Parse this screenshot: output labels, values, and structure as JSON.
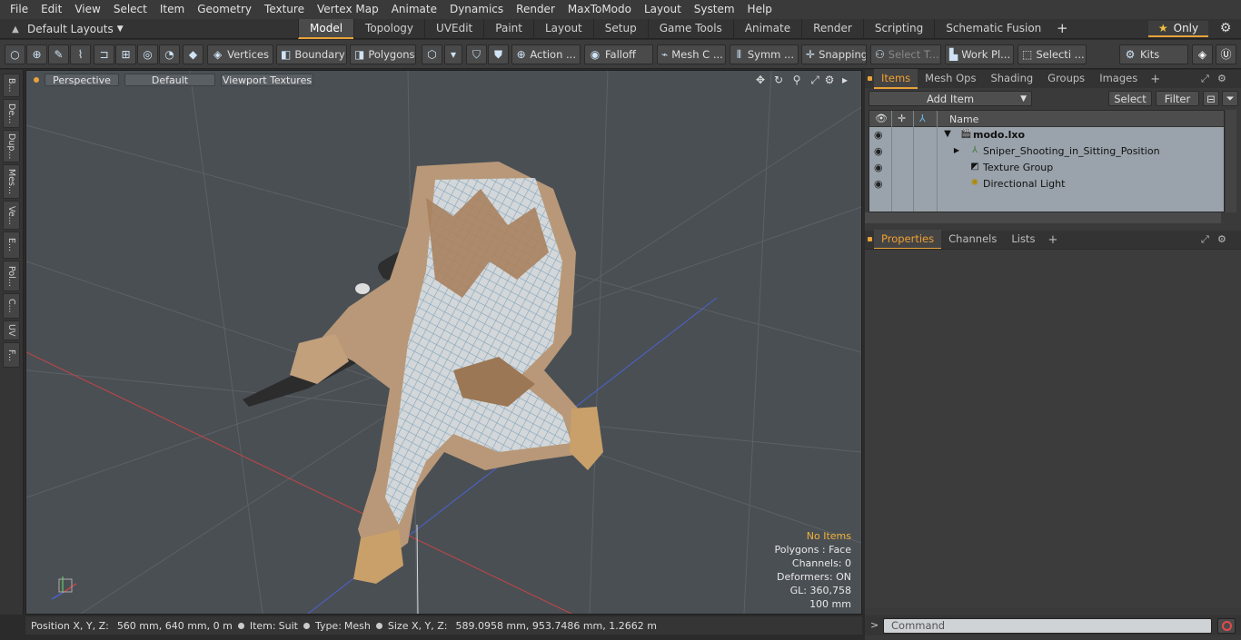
{
  "menu": [
    "File",
    "Edit",
    "View",
    "Select",
    "Item",
    "Geometry",
    "Texture",
    "Vertex Map",
    "Animate",
    "Dynamics",
    "Render",
    "MaxToModo",
    "Layout",
    "System",
    "Help"
  ],
  "layout_select": "Default Layouts",
  "tabs": [
    "Model",
    "Topology",
    "UVEdit",
    "Paint",
    "Layout",
    "Setup",
    "Game Tools",
    "Animate",
    "Render",
    "Scripting",
    "Schematic Fusion"
  ],
  "active_tab": "Model",
  "only_label": "Only",
  "toolbar": {
    "vertices": "Vertices",
    "boundary": "Boundary",
    "polygons": "Polygons",
    "action": "Action ...",
    "falloff": "Falloff",
    "mesh_c": "Mesh C ...",
    "symm": "Symm ...",
    "snapping": "Snapping",
    "select_t": "Select T...",
    "work_pl": "Work Pl...",
    "selecti": "Selecti ...",
    "kits": "Kits"
  },
  "left_tabs": [
    "B...",
    "De...",
    "Dup...",
    "Mes...",
    "Ve...",
    "E...",
    "Pol...",
    "C...",
    "UV",
    "F..."
  ],
  "viewport": {
    "view": "Perspective",
    "shading": "Default",
    "textures": "Viewport Textures",
    "info": {
      "status": "No Items",
      "polygons": "Polygons : Face",
      "channels": "Channels: 0",
      "deformers": "Deformers: ON",
      "gl": "GL: 360,758",
      "unit": "100 mm"
    }
  },
  "statusbar": {
    "position_label": "Position X, Y, Z:",
    "position_value": "560 mm, 640 mm, 0 m",
    "item_label": "Item:",
    "item_value": "Suit",
    "type_label": "Type:",
    "type_value": "Mesh",
    "size_label": "Size X, Y, Z:",
    "size_value": "589.0958 mm, 953.7486 mm, 1.2662 m"
  },
  "items_panel": {
    "tabs": [
      "Items",
      "Mesh Ops",
      "Shading",
      "Groups",
      "Images"
    ],
    "active": "Items",
    "add_item": "Add Item",
    "select": "Select",
    "filter": "Filter",
    "column_name": "Name",
    "tree": [
      {
        "label": "modo.lxo",
        "level": 0
      },
      {
        "label": "Sniper_Shooting_in_Sitting_Position",
        "level": 1
      },
      {
        "label": "Texture Group",
        "level": 1
      },
      {
        "label": "Directional Light",
        "level": 1
      }
    ]
  },
  "props_panel": {
    "tabs": [
      "Properties",
      "Channels",
      "Lists"
    ],
    "active": "Properties"
  },
  "command": {
    "prompt": ">",
    "placeholder": "Command"
  },
  "colors": {
    "accent": "#e8a23a",
    "viewport_bg": "#4a4f54",
    "tree_bg": "#9aa3ab"
  }
}
